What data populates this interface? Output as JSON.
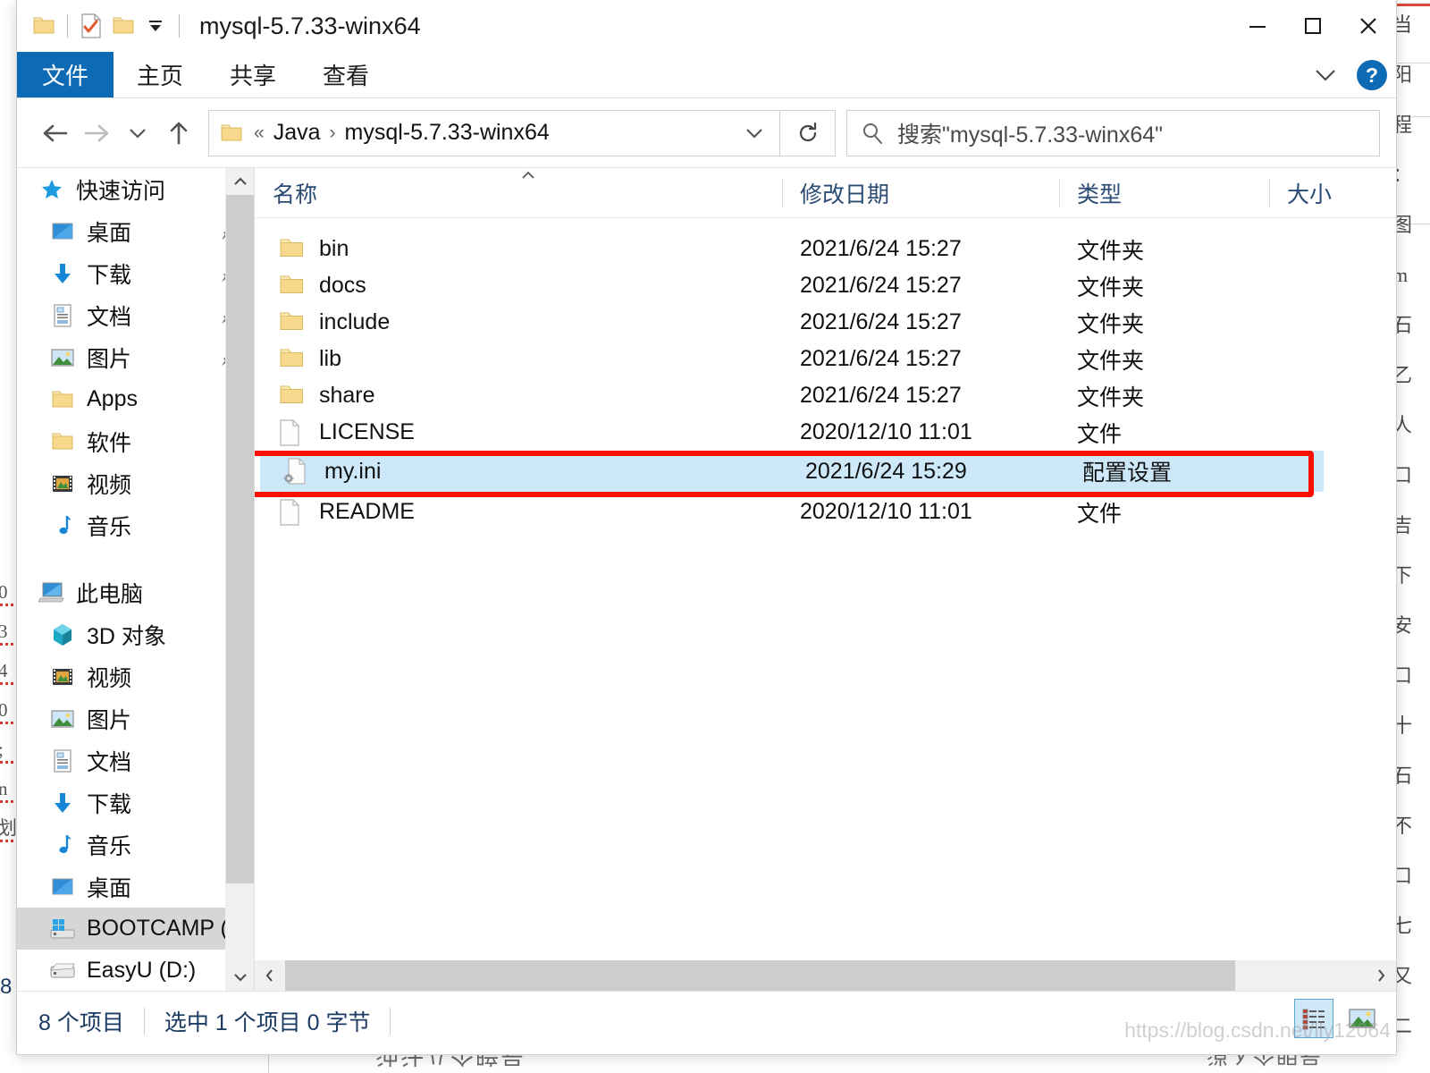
{
  "window": {
    "title": "mysql-5.7.33-winx64",
    "quick_access": [
      {
        "name": "folder-icon",
        "label": "文件夹"
      },
      {
        "name": "properties-icon",
        "label": "属性"
      },
      {
        "name": "new-folder-icon",
        "label": "新建文件夹"
      },
      {
        "name": "customize-dropdown-icon",
        "label": "自定义快速访问工具栏"
      }
    ],
    "controls": {
      "minimize": "最小化",
      "maximize": "最大化",
      "close": "关闭"
    }
  },
  "ribbon": {
    "tabs": [
      {
        "label": "文件",
        "active": true
      },
      {
        "label": "主页",
        "active": false
      },
      {
        "label": "共享",
        "active": false
      },
      {
        "label": "查看",
        "active": false
      }
    ],
    "expand_label": "展开功能区",
    "help_label": "?"
  },
  "navigation": {
    "back_label": "后退",
    "forward_label": "前进",
    "recent_label": "最近浏览的位置",
    "up_label": "向上",
    "refresh_label": "刷新",
    "breadcrumb": {
      "overflow": "«",
      "items": [
        "Java",
        "mysql-5.7.33-winx64"
      ],
      "separator": "›"
    },
    "dropdown_label": "历史记录"
  },
  "search": {
    "placeholder": "搜索\"mysql-5.7.33-winx64\"",
    "icon": "search-icon"
  },
  "sidebar": {
    "groups": [
      {
        "root": {
          "label": "快速访问",
          "icon": "star-icon"
        },
        "items": [
          {
            "label": "桌面",
            "icon": "desktop-icon",
            "pinned": true
          },
          {
            "label": "下载",
            "icon": "download-icon",
            "pinned": true
          },
          {
            "label": "文档",
            "icon": "documents-icon",
            "pinned": true
          },
          {
            "label": "图片",
            "icon": "pictures-icon",
            "pinned": true
          },
          {
            "label": "Apps",
            "icon": "folder-icon",
            "pinned": false
          },
          {
            "label": "软件",
            "icon": "folder-icon",
            "pinned": false
          },
          {
            "label": "视频",
            "icon": "videos-icon",
            "pinned": false
          },
          {
            "label": "音乐",
            "icon": "music-icon",
            "pinned": false
          }
        ]
      },
      {
        "root": {
          "label": "此电脑",
          "icon": "this-pc-icon"
        },
        "items": [
          {
            "label": "3D 对象",
            "icon": "3d-objects-icon",
            "pinned": false
          },
          {
            "label": "视频",
            "icon": "videos-icon",
            "pinned": false
          },
          {
            "label": "图片",
            "icon": "pictures-icon",
            "pinned": false
          },
          {
            "label": "文档",
            "icon": "documents-icon",
            "pinned": false
          },
          {
            "label": "下载",
            "icon": "download-icon",
            "pinned": false
          },
          {
            "label": "音乐",
            "icon": "music-icon",
            "pinned": false
          },
          {
            "label": "桌面",
            "icon": "desktop-icon",
            "pinned": false
          },
          {
            "label": "BOOTCAMP (C:",
            "icon": "windows-drive-icon",
            "pinned": false,
            "selected": true
          },
          {
            "label": "EasyU (D:)",
            "icon": "drive-icon",
            "pinned": false
          }
        ]
      }
    ]
  },
  "file_list": {
    "columns": [
      {
        "key": "name",
        "label": "名称",
        "sorted": true,
        "sort_dir": "asc"
      },
      {
        "key": "date",
        "label": "修改日期"
      },
      {
        "key": "type",
        "label": "类型"
      },
      {
        "key": "size",
        "label": "大小"
      }
    ],
    "rows": [
      {
        "name": "bin",
        "date": "2021/6/24 15:27",
        "type": "文件夹",
        "size": "",
        "icon": "folder-icon",
        "selected": false
      },
      {
        "name": "docs",
        "date": "2021/6/24 15:27",
        "type": "文件夹",
        "size": "",
        "icon": "folder-icon",
        "selected": false
      },
      {
        "name": "include",
        "date": "2021/6/24 15:27",
        "type": "文件夹",
        "size": "",
        "icon": "folder-icon",
        "selected": false
      },
      {
        "name": "lib",
        "date": "2021/6/24 15:27",
        "type": "文件夹",
        "size": "",
        "icon": "folder-icon",
        "selected": false
      },
      {
        "name": "share",
        "date": "2021/6/24 15:27",
        "type": "文件夹",
        "size": "",
        "icon": "folder-icon",
        "selected": false
      },
      {
        "name": "LICENSE",
        "date": "2020/12/10 11:01",
        "type": "文件",
        "size": "",
        "icon": "file-icon",
        "selected": false
      },
      {
        "name": "my.ini",
        "date": "2021/6/24 15:29",
        "type": "配置设置",
        "size": "",
        "icon": "ini-file-icon",
        "selected": true
      },
      {
        "name": "README",
        "date": "2020/12/10 11:01",
        "type": "文件",
        "size": "",
        "icon": "file-icon",
        "selected": false
      }
    ],
    "highlight_row_index": 6,
    "highlight_color": "#fa0f05"
  },
  "status_bar": {
    "item_count": "8 个项目",
    "selection": "选中 1 个项目  0 字节",
    "views": [
      {
        "name": "details-view-icon",
        "label": "详细信息",
        "active": true
      },
      {
        "name": "large-icons-view-icon",
        "label": "大图标",
        "active": false
      }
    ]
  },
  "scrollbars": {
    "nav_up": "▲",
    "nav_down": "▼",
    "h_left": "‹",
    "h_right": "›"
  },
  "watermark": {
    "text": "https://blog.csdn.net/lly12064"
  },
  "background": {
    "left_fragments": [
      "ρ",
      "3",
      "4",
      "0",
      ";",
      "ny",
      "划"
    ],
    "right_fragments": [
      "当",
      "阳",
      "程",
      "：",
      "图",
      "m"
    ],
    "bottom_text": "油汁八个暗号",
    "bottom_text2": "消入个明号"
  },
  "colors": {
    "accent": "#0d6ab5",
    "selection": "#cde8f9",
    "header_text": "#2a4b73",
    "highlight": "#fa0f05",
    "sidebar_selected": "#d6d6d6"
  }
}
